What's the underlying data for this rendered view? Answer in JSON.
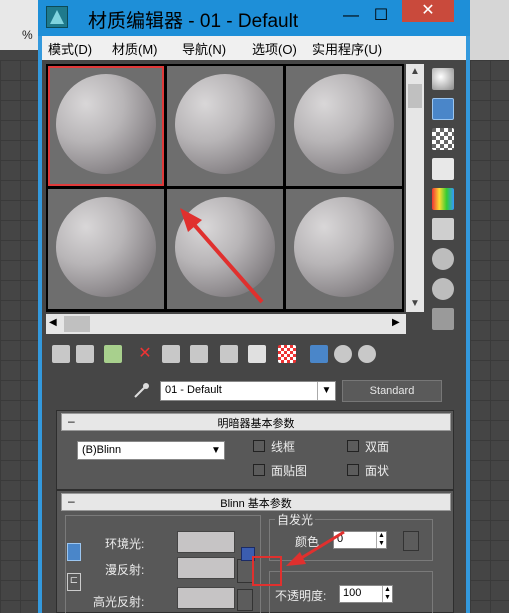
{
  "window": {
    "title": "材质编辑器 - 01 - Default",
    "minimize": "—",
    "maximize": "☐",
    "close": "✕"
  },
  "background": {
    "left_symbol": "%"
  },
  "menu": [
    "模式(D)",
    "材质(M)",
    "导航(N)",
    "选项(O)",
    "实用程序(U)"
  ],
  "material": {
    "name": "01 - Default",
    "type_button": "Standard"
  },
  "shader_rollout": {
    "title": "明暗器基本参数",
    "shader": "(B)Blinn",
    "options": [
      "线框",
      "双面",
      "面贴图",
      "面状"
    ]
  },
  "blinn_rollout": {
    "title": "Blinn 基本参数",
    "self_illum_title": "自发光",
    "color_label": "颜色",
    "color_value": "0",
    "ambient_label": "环境光:",
    "diffuse_label": "漫反射:",
    "specular_label": "高光反射:",
    "opacity_label": "不透明度:",
    "opacity_value": "100"
  },
  "icons": {
    "eyedropper": "eyedropper-icon",
    "lock": "lock-icon"
  }
}
